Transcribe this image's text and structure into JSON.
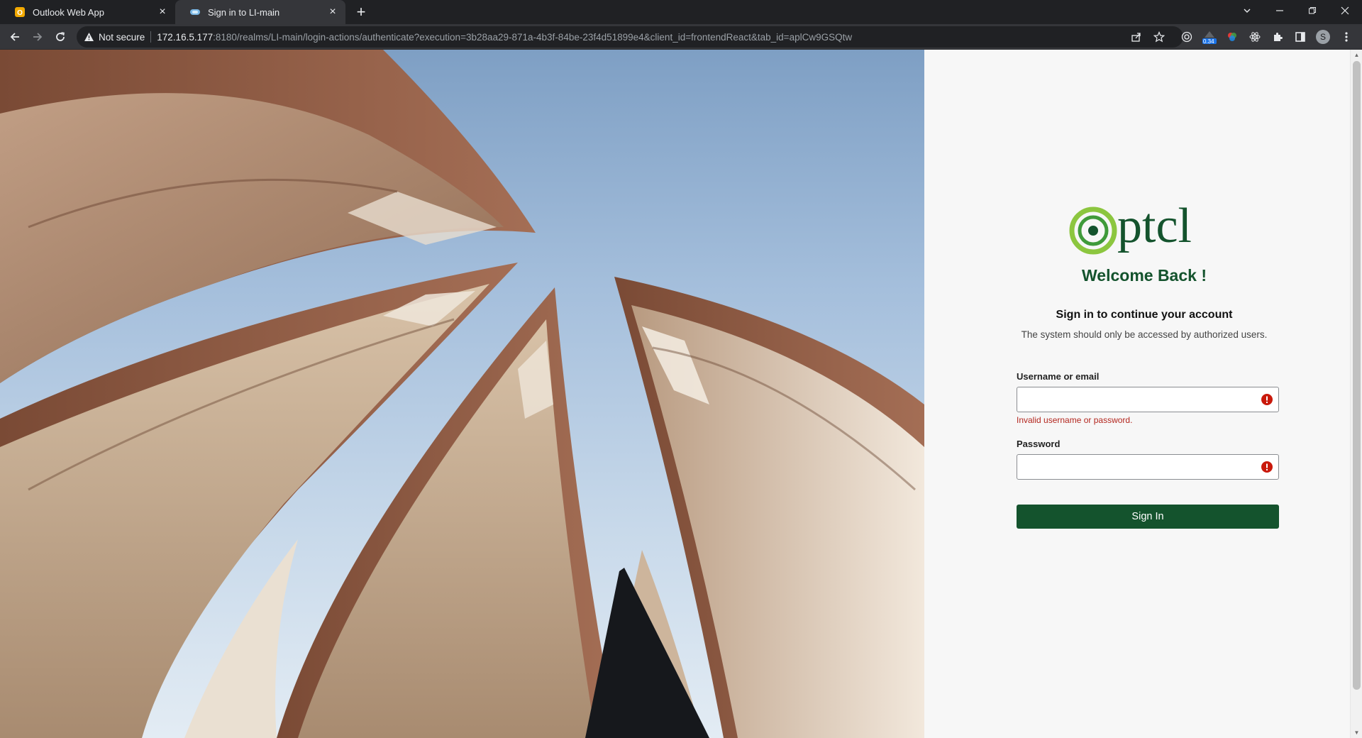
{
  "browser": {
    "tabs": [
      {
        "title": "Outlook Web App",
        "favicon": "outlook-icon",
        "active": false
      },
      {
        "title": "Sign in to LI-main",
        "favicon": "keycloak-icon",
        "active": true
      }
    ],
    "security_label": "Not secure",
    "url_host": "172.16.5.177",
    "url_path": ":8180/realms/LI-main/login-actions/authenticate?execution=3b28aa29-871a-4b3f-84be-23f4d51899e4&client_id=frontendReact&tab_id=aplCw9GSQtw",
    "extension_badge": "0.34",
    "profile_initial": "S"
  },
  "login": {
    "logo_text": "ptcl",
    "welcome": "Welcome Back !",
    "subtitle": "Sign in to continue your account",
    "notice": "The system should only be accessed by authorized users.",
    "username_label": "Username or email",
    "username_value": "",
    "username_error": "Invalid username or password.",
    "password_label": "Password",
    "password_value": "",
    "submit_label": "Sign In"
  },
  "colors": {
    "brand_green": "#14532d",
    "logo_light_green": "#8cc63f",
    "error_red": "#b3261e"
  }
}
